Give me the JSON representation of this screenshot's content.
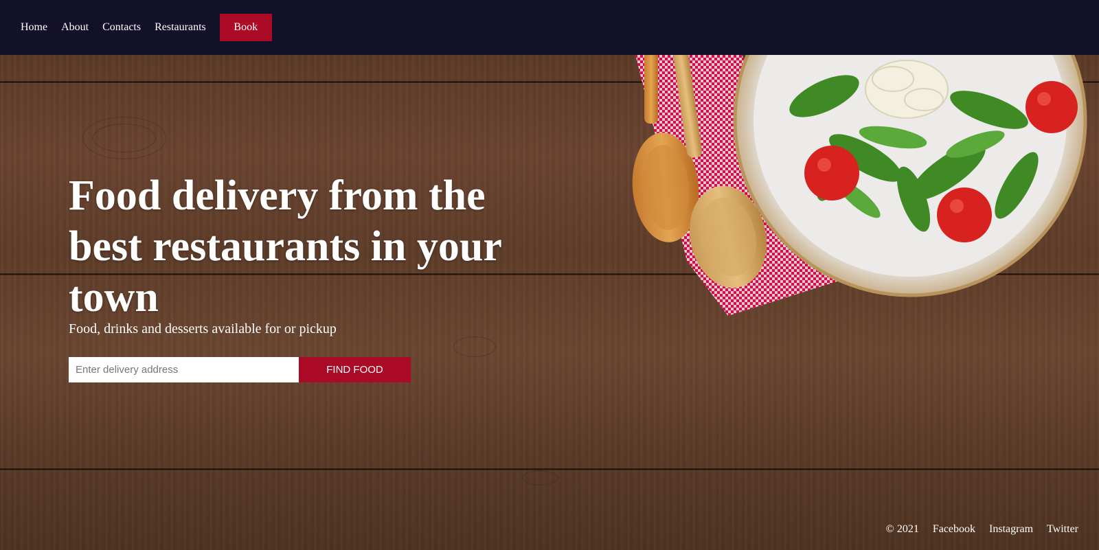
{
  "nav": {
    "links": [
      {
        "label": "Home"
      },
      {
        "label": "About"
      },
      {
        "label": "Contacts"
      },
      {
        "label": "Restaurants"
      }
    ],
    "book_label": "Book"
  },
  "hero": {
    "title": "Food delivery from the best restaurants in your town",
    "subtitle": "Food, drinks and desserts available for or pickup",
    "search": {
      "placeholder": "Enter delivery address",
      "value": "",
      "button_label": "FIND FOOD"
    }
  },
  "footer": {
    "copyright": "© 2021",
    "links": [
      {
        "label": "Facebook"
      },
      {
        "label": "Instagram"
      },
      {
        "label": "Twitter"
      }
    ]
  },
  "colors": {
    "nav_background": "#13102a",
    "accent": "#ab0a27",
    "text": "#ffffff"
  },
  "icons": [
    "wooden-spoon-icon",
    "salad-plate-icon",
    "checkered-napkin-icon"
  ]
}
